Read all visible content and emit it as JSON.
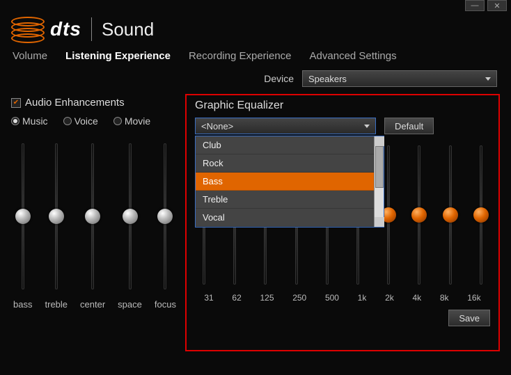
{
  "window": {
    "minimize_label": "—",
    "close_label": "✕"
  },
  "brand": {
    "dts": "dts",
    "sound": "Sound"
  },
  "tabs": {
    "volume": "Volume",
    "listening": "Listening Experience",
    "recording": "Recording Experience",
    "advanced": "Advanced Settings",
    "active": "listening"
  },
  "device": {
    "label": "Device",
    "selected": "Speakers"
  },
  "enhancements": {
    "label": "Audio Enhancements",
    "checked": true,
    "modes": {
      "music": "Music",
      "voice": "Voice",
      "movie": "Movie",
      "selected": "music"
    }
  },
  "left_sliders": {
    "items": [
      {
        "label": "bass",
        "pos": 50
      },
      {
        "label": "treble",
        "pos": 50
      },
      {
        "label": "center",
        "pos": 50
      },
      {
        "label": "space",
        "pos": 50
      },
      {
        "label": "focus",
        "pos": 50
      }
    ]
  },
  "eq": {
    "title": "Graphic Equalizer",
    "preset_selected": "<None>",
    "default_btn": "Default",
    "save_btn": "Save",
    "dropdown": {
      "open": true,
      "highlighted": "Bass",
      "visible_items": [
        "Club",
        "Rock",
        "Bass",
        "Treble",
        "Vocal"
      ]
    },
    "bands": [
      {
        "freq": "31",
        "pos": 50
      },
      {
        "freq": "62",
        "pos": 50
      },
      {
        "freq": "125",
        "pos": 50
      },
      {
        "freq": "250",
        "pos": 50
      },
      {
        "freq": "500",
        "pos": 50
      },
      {
        "freq": "1k",
        "pos": 50
      },
      {
        "freq": "2k",
        "pos": 50
      },
      {
        "freq": "4k",
        "pos": 50
      },
      {
        "freq": "8k",
        "pos": 50
      },
      {
        "freq": "16k",
        "pos": 50
      }
    ]
  }
}
